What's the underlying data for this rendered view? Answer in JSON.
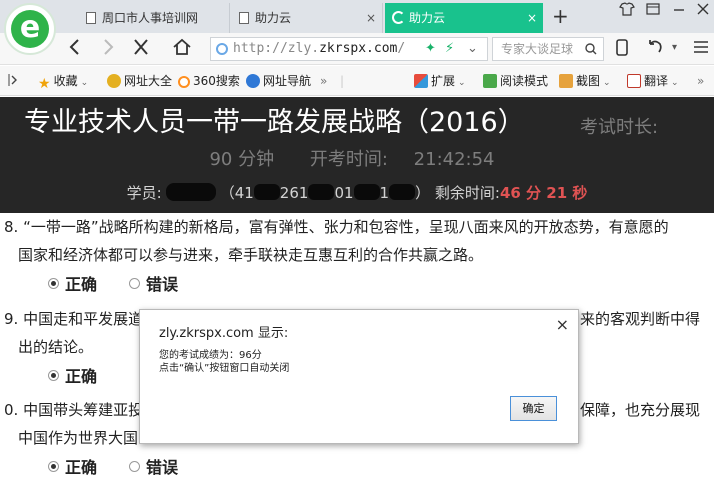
{
  "browser": {
    "tabs": [
      {
        "title": "周口市人事培训网",
        "active": false
      },
      {
        "title": "助力云",
        "active": false
      },
      {
        "title": "助力云",
        "active": true
      }
    ],
    "tab_close": "×",
    "new_tab": "+",
    "url_prefix": "http://zly.",
    "url_domain": "zkrspx.com",
    "url_suffix": "/",
    "search_placeholder": "专家大谈足球",
    "bookmarks": [
      {
        "label": "收藏",
        "icon": "star-icon",
        "caret": true
      },
      {
        "label": "网址大全",
        "icon": "plus-circle-icon",
        "caret": false
      },
      {
        "label": "360搜索",
        "icon": "360-icon",
        "caret": false
      },
      {
        "label": "网址导航",
        "icon": "compass-icon",
        "caret": false
      },
      {
        "label": "扩展",
        "icon": "extension-icon",
        "caret": true
      },
      {
        "label": "阅读模式",
        "icon": "book-icon",
        "caret": false
      },
      {
        "label": "截图",
        "icon": "scissors-icon",
        "caret": true
      },
      {
        "label": "翻译",
        "icon": "translate-icon",
        "caret": true
      }
    ],
    "more_chevron": "»",
    "accent": "#19c28d"
  },
  "exam": {
    "title": "专业技术人员一带一路发展战略（2016）",
    "duration_label": "考试时长:",
    "duration": "90 分钟",
    "start_label": "开考时间:",
    "start_time": "21:42:54",
    "student_label": "学员:",
    "id_open": "（41",
    "id_mid": "261",
    "id_mid2": "01",
    "id_close": "1",
    "id_end": "）",
    "remaining_label": "剩余时间:",
    "remaining": "46 分 21 秒"
  },
  "questions": [
    {
      "line1": "8. “一带一路”战略所构建的新格局，富有弹性、张力和包容性，呈现八面来风的开放态势，有意愿的",
      "line2": "国家和经济体都可以参与进来，牵手联袂走互惠互利的合作共赢之路。",
      "options": [
        {
          "label": "正确",
          "checked": true
        },
        {
          "label": "错误",
          "checked": false
        }
      ]
    },
    {
      "line1_left": "9. 中国走和平发展道",
      "line1_right": "来的客观判断中得",
      "line2": "出的结论。",
      "options": [
        {
          "label": "正确",
          "checked": true
        }
      ]
    },
    {
      "line1_left": "0. 中国带头筹建亚投",
      "line1_right": "保障，也充分展现",
      "line2": "中国作为世界大国",
      "options": [
        {
          "label": "正确",
          "checked": true
        },
        {
          "label": "错误",
          "checked": false
        }
      ]
    }
  ],
  "dialog": {
    "title": "zly.zkrspx.com 显示:",
    "close": "×",
    "message_line1": "您的考试成绩为：96分",
    "message_line2": "点击“确认”按钮窗口自动关闭",
    "ok_label": "确定"
  }
}
